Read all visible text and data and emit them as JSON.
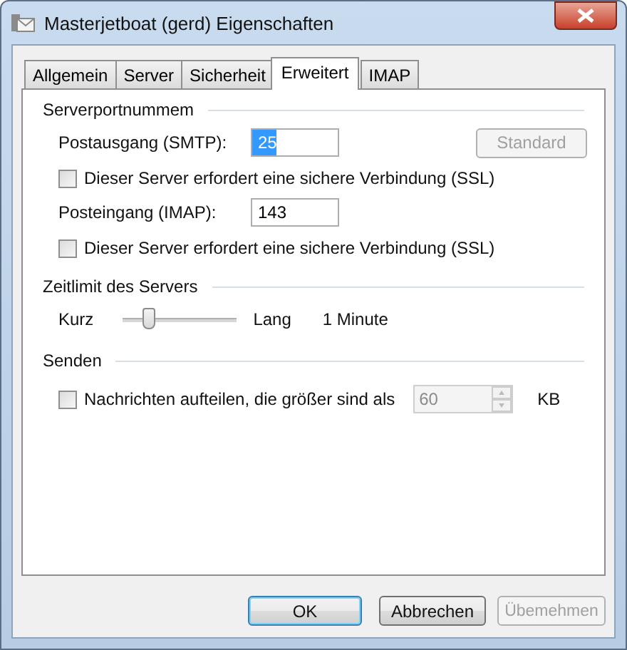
{
  "window": {
    "title": "Masterjetboat (gerd) Eigenschaften"
  },
  "tabs": [
    {
      "label": "Allgemein",
      "selected": false
    },
    {
      "label": "Server",
      "selected": false
    },
    {
      "label": "Sicherheit",
      "selected": false
    },
    {
      "label": "Erweitert",
      "selected": true
    },
    {
      "label": "IMAP",
      "selected": false
    }
  ],
  "ports": {
    "heading": "Serverportnummem",
    "outgoing_label": "Postausgang (SMTP):",
    "outgoing_value": "25",
    "default_button": {
      "label": "Standard",
      "disabled": true
    },
    "outgoing_ssl": {
      "label": "Dieser Server erfordert eine sichere Verbindung (SSL)",
      "checked": false
    },
    "incoming_label": "Posteingang (IMAP):",
    "incoming_value": "143",
    "incoming_ssl": {
      "label": "Dieser Server erfordert eine sichere Verbindung (SSL)",
      "checked": false
    }
  },
  "timeout": {
    "heading": "Zeitlimit des Servers",
    "min_label": "Kurz",
    "max_label": "Lang",
    "level": 0.2,
    "reading": "1 Minute"
  },
  "sending": {
    "heading": "Senden",
    "split": {
      "label": "Nachrichten aufteilen, die größer sind als",
      "checked": false
    },
    "size_value": "60",
    "size_disabled": true,
    "unit": "KB"
  },
  "buttons": [
    {
      "label": "OK",
      "disabled": false,
      "default": true
    },
    {
      "label": "Abbrechen",
      "disabled": false,
      "default": false
    },
    {
      "label": "Übemehmen",
      "disabled": true,
      "default": false
    }
  ]
}
